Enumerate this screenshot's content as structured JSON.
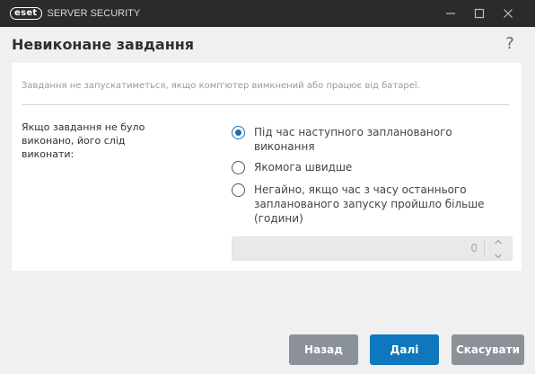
{
  "window": {
    "logo_text": "eset",
    "product_name": "SERVER SECURITY",
    "icons": {
      "minimize": "minimize-icon",
      "maximize": "maximize-icon",
      "close": "close-icon"
    }
  },
  "page": {
    "title": "Невиконане завдання",
    "help_label": "?"
  },
  "panel": {
    "hint": "Завдання не запускатиметься, якщо комп'ютер вимкнений або працює від батареї.",
    "field_label": "Якщо завдання не було виконано, його слід виконати:",
    "options": [
      {
        "label": "Під час наступного запланованого виконання",
        "checked": true
      },
      {
        "label": "Якомога швидше",
        "checked": false
      },
      {
        "label": "Негайно, якщо час з часу останнього запланованого запуску пройшло більше (години)",
        "checked": false
      }
    ],
    "stepper": {
      "value": "0",
      "enabled": false
    }
  },
  "footer": {
    "back_label": "Назад",
    "next_label": "Далі",
    "cancel_label": "Скасувати"
  },
  "colors": {
    "titlebar": "#2b2b2b",
    "accent": "#0f77bd",
    "secondary_button": "#8a9199"
  }
}
